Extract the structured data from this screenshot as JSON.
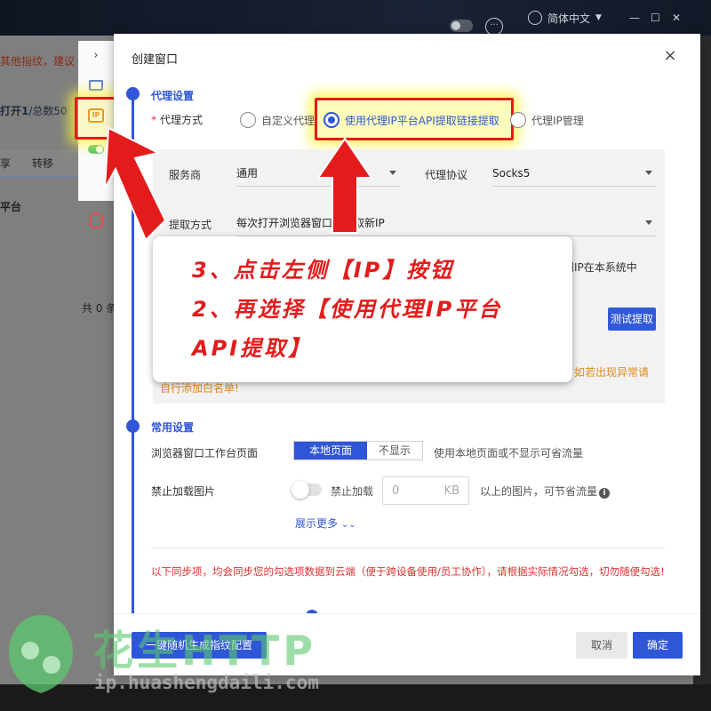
{
  "app": {
    "language": "简体中文",
    "window_controls": [
      "—",
      "☐",
      "✕"
    ]
  },
  "background": {
    "notice": "其他指纹，建议",
    "count_prefix": "打开1",
    "count_suffix": "/总数50",
    "columns": [
      "享",
      "转移"
    ],
    "platform": "平台",
    "total": "共 0 条"
  },
  "sidebar": {
    "icons": [
      "chevron-right-icon",
      "monitor-icon",
      "ip-icon",
      "switch-icon",
      "fingerprint-icon"
    ]
  },
  "dialog": {
    "title": "创建窗口",
    "close": "×",
    "proxy_section": {
      "title": "代理设置",
      "mode_label": "代理方式",
      "options": [
        "自定义代理",
        "使用代理IP平台API提取链接提取",
        "代理IP管理"
      ],
      "selected": "使用代理IP平台API提取链接提取",
      "provider_label": "服务商",
      "provider_value": "通用",
      "protocol_label": "代理协议",
      "protocol_value": "Socks5",
      "extract_label": "提取方式",
      "extract_value": "每次打开浏览器窗口都提取新IP",
      "right_fragment": "到IP在本系统中",
      "test_button": "测试提取",
      "warn_fragment_right": "如若出现异常请",
      "warn_fragment_left": "自行添加白名单!"
    },
    "common_section": {
      "title": "常用设置",
      "workbench_label": "浏览器窗口工作台页面",
      "workbench_options": [
        "本地页面",
        "不显示"
      ],
      "workbench_hint": "使用本地页面或不显示可省流量",
      "image_label": "禁止加载图片",
      "image_toggle_label": "禁止加载",
      "image_input_placeholder": "0",
      "image_input_unit": "KB",
      "image_hint": "以上的图片，可节省流量",
      "show_more": "展示更多",
      "sync_note": "以下同步项，均会同步您的勾选项数据到云端（便于跨设备使用/员工协作），请根据实际情况勾选，切勿随便勾选!"
    },
    "footer": {
      "generate": "一键随机生成指纹配置",
      "cancel": "取消",
      "confirm": "确定"
    }
  },
  "callout": {
    "lines": [
      "3、点击左侧【IP】按钮",
      "2、再选择【使用代理IP平台",
      "API提取】"
    ]
  },
  "watermark": {
    "brand": "花生HTTP",
    "url": "ip.huashengdaili.com"
  },
  "colors": {
    "primary": "#2f56d6",
    "annotation_red": "#e41b1b",
    "highlight_yellow": "#faf53c",
    "warning": "#e08a1c"
  }
}
